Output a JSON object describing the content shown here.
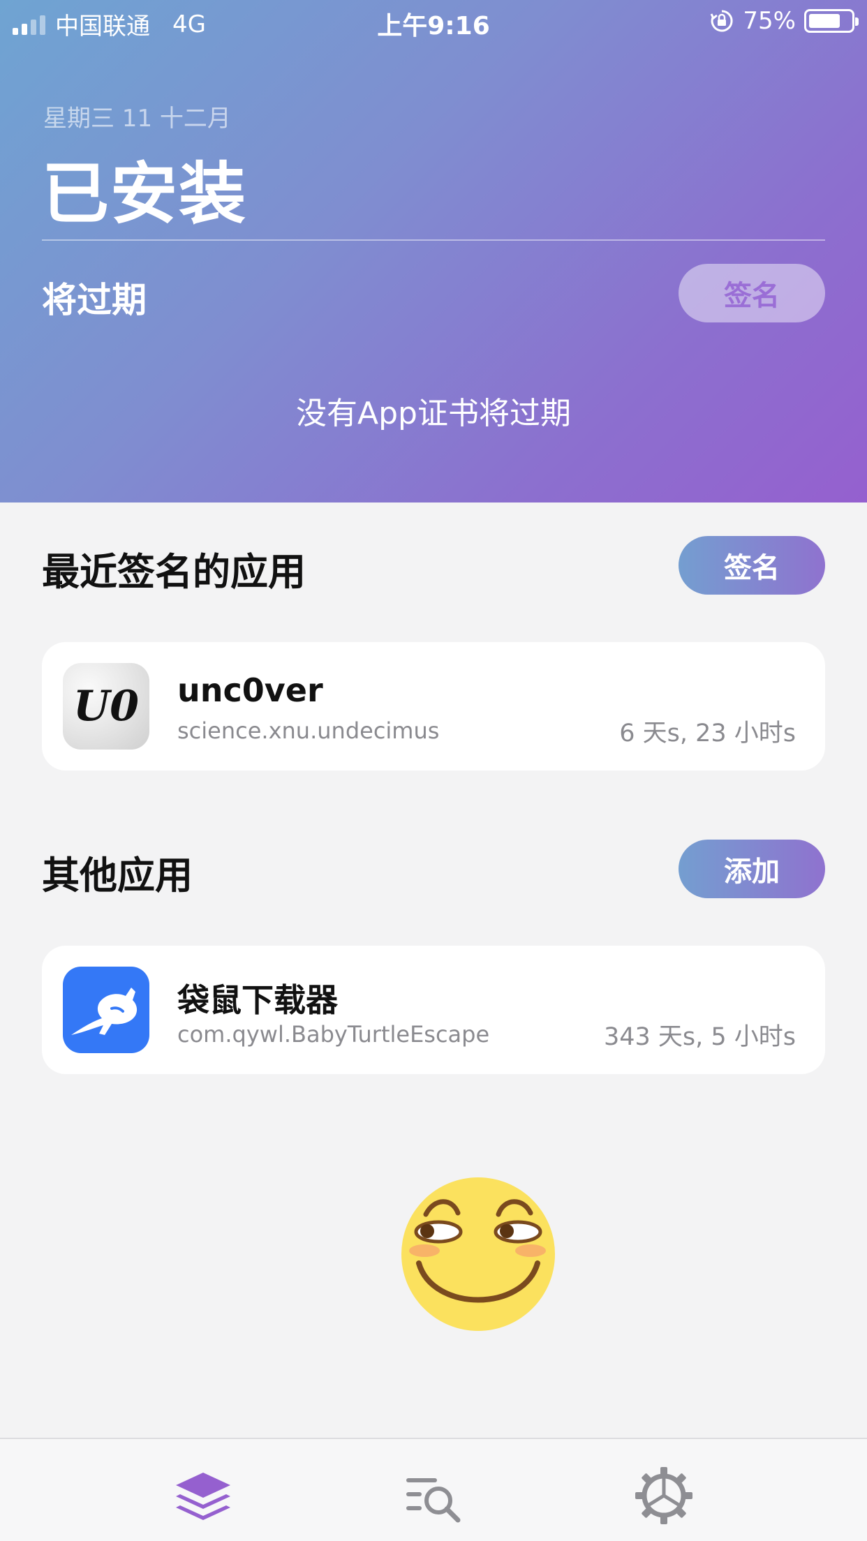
{
  "status_bar": {
    "carrier": "中国联通",
    "network": "4G",
    "time": "上午9:16",
    "battery": "75%",
    "battery_level": 0.75
  },
  "header": {
    "date": "星期三 11 十二月",
    "title": "已安装",
    "expiring_title": "将过期",
    "expiring_button": "签名",
    "empty_message": "没有App证书将过期"
  },
  "recent": {
    "title": "最近签名的应用",
    "button": "签名",
    "apps": [
      {
        "name": "unc0ver",
        "bundle_id": "science.xnu.undecimus",
        "expires": "6 天s, 23 小时s",
        "icon": "unc0ver-logo-icon",
        "icon_text": "U0"
      }
    ]
  },
  "others": {
    "title": "其他应用",
    "button": "添加",
    "apps": [
      {
        "name": "袋鼠下载器",
        "bundle_id": "com.qywl.BabyTurtleEscape",
        "expires": "343 天s, 5 小时s",
        "icon": "kangaroo-icon"
      }
    ]
  },
  "tabbar": {
    "items": [
      {
        "icon": "layers-icon",
        "active": true
      },
      {
        "icon": "browse-search-icon",
        "active": false
      },
      {
        "icon": "settings-gear-icon",
        "active": false
      }
    ]
  },
  "colors": {
    "accent": "#9560cf",
    "gradient_start": "#6fa4d2",
    "tab_inactive": "#8e8e93",
    "kangaroo_blue": "#3478f6"
  },
  "decoration": {
    "emoji": "smirking-face-emoji"
  }
}
